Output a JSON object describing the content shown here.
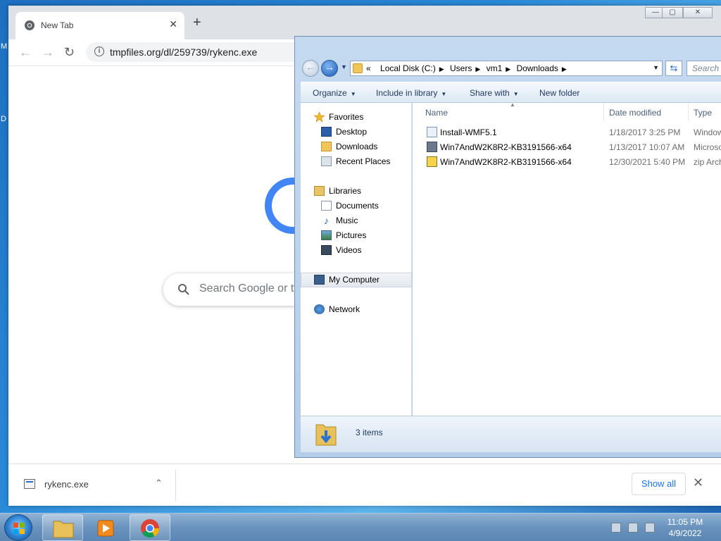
{
  "desktop": {
    "frag1": "M",
    "frag2": "D"
  },
  "chrome": {
    "tab_title": "New Tab",
    "tab_close": "✕",
    "new_tab": "+",
    "url": "tmpfiles.org/dl/259739/rykenc.exe",
    "back": "←",
    "forward": "→",
    "reload": "↻",
    "search_placeholder": "Search Google or ty",
    "download": {
      "file_name": "rykenc.exe",
      "chevron": "⌃",
      "show_all": "Show all",
      "close": "✕"
    },
    "window_controls": {
      "minimize": "—",
      "restore": "▢",
      "close": "✕"
    }
  },
  "explorer": {
    "breadcrumb_prefix": "«",
    "breadcrumbs": [
      "Local Disk (C:)",
      "Users",
      "vm1",
      "Downloads"
    ],
    "search_placeholder": "Search Downloads",
    "commands": [
      "Organize",
      "Include in library",
      "Share with",
      "New folder"
    ],
    "nav": {
      "favorites_header": "Favorites",
      "favorites": [
        "Desktop",
        "Downloads",
        "Recent Places"
      ],
      "libraries_header": "Libraries",
      "libraries": [
        "Documents",
        "Music",
        "Pictures",
        "Videos"
      ],
      "computer": "My Computer",
      "network": "Network"
    },
    "columns": [
      "Name",
      "Date modified",
      "Type"
    ],
    "files": [
      {
        "name": "Install-WMF5.1",
        "date": "1/18/2017 3:25 PM",
        "type": "Window"
      },
      {
        "name": "Win7AndW2K8R2-KB3191566-x64",
        "date": "1/13/2017 10:07 AM",
        "type": "Microso"
      },
      {
        "name": "Win7AndW2K8R2-KB3191566-x64",
        "date": "12/30/2021 5:40 PM",
        "type": "zip Arch"
      }
    ],
    "item_count": "3 items"
  },
  "taskbar": {
    "time": "11:05 PM",
    "date": "4/9/2022"
  },
  "colors": {
    "chrome_blue": "#1a73e8",
    "explorer_frame": "#c5daf0",
    "taskbar": "#6a93bd"
  }
}
